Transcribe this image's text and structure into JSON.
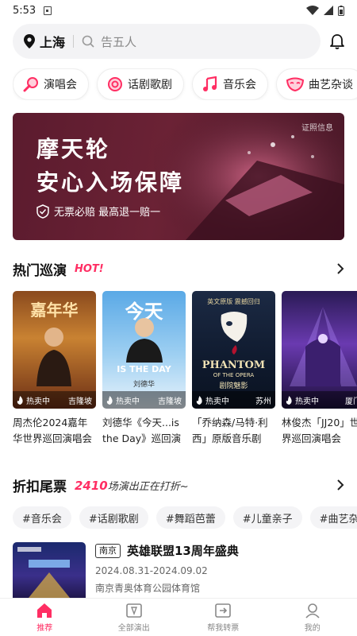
{
  "status_bar": {
    "time": "5:53"
  },
  "search": {
    "city": "上海",
    "placeholder": "告五人"
  },
  "categories": [
    {
      "label": "演唱会",
      "icon": "mic-icon"
    },
    {
      "label": "话剧歌剧",
      "icon": "theater-icon"
    },
    {
      "label": "音乐会",
      "icon": "music-note-icon"
    },
    {
      "label": "曲艺杂谈",
      "icon": "mask-icon"
    }
  ],
  "banner": {
    "line1": "摩天轮",
    "line2": "安心入场保障",
    "guarantee": "无票必赔 最高退一赔一",
    "cert": "证照信息"
  },
  "hot_tours": {
    "title": "热门巡演",
    "badge": "HOT!",
    "items": [
      {
        "status": "热卖中",
        "city": "吉隆坡",
        "name": "周杰伦2024嘉年华世界巡回演唱会",
        "poster_text": "嘉年华"
      },
      {
        "status": "热卖中",
        "city": "吉隆坡",
        "name": "刘德华《今天...is the Day》巡回演唱会",
        "poster_text": "今天",
        "poster_sub": "IS THE DAY",
        "poster_name": "刘德华"
      },
      {
        "status": "热卖中",
        "city": "苏州",
        "name": "「乔纳森/马特·利西」原版音乐剧《剧院魅影》",
        "poster_text": "PHANTOM",
        "poster_sub": "OF THE OPERA",
        "poster_top": "英文原版 震撼回归",
        "poster_cn": "剧院魅影"
      },
      {
        "status": "热卖中",
        "city": "厦门",
        "name": "林俊杰「JJ20」世界巡回演唱会",
        "poster_text": ""
      }
    ]
  },
  "discount": {
    "title": "折扣尾票",
    "count": "2410",
    "subtitle": "场演出正在打折~",
    "tags": [
      "#音乐会",
      "#话剧歌剧",
      "#舞蹈芭蕾",
      "#儿童亲子",
      "#曲艺杂谈"
    ]
  },
  "deal": {
    "city": "南京",
    "title": "英雄联盟13周年盛典",
    "date": "2024.08.31-2024.09.02",
    "venue": "南京青奥体育公园体育馆"
  },
  "tabs": [
    {
      "label": "推荐",
      "icon": "home-icon",
      "active": true
    },
    {
      "label": "全部演出",
      "icon": "ticket-icon",
      "active": false
    },
    {
      "label": "帮我转票",
      "icon": "transfer-icon",
      "active": false
    },
    {
      "label": "我的",
      "icon": "user-icon",
      "active": false
    }
  ],
  "colors": {
    "accent": "#ff2e63",
    "banner_bg": "#5b1b2e"
  }
}
